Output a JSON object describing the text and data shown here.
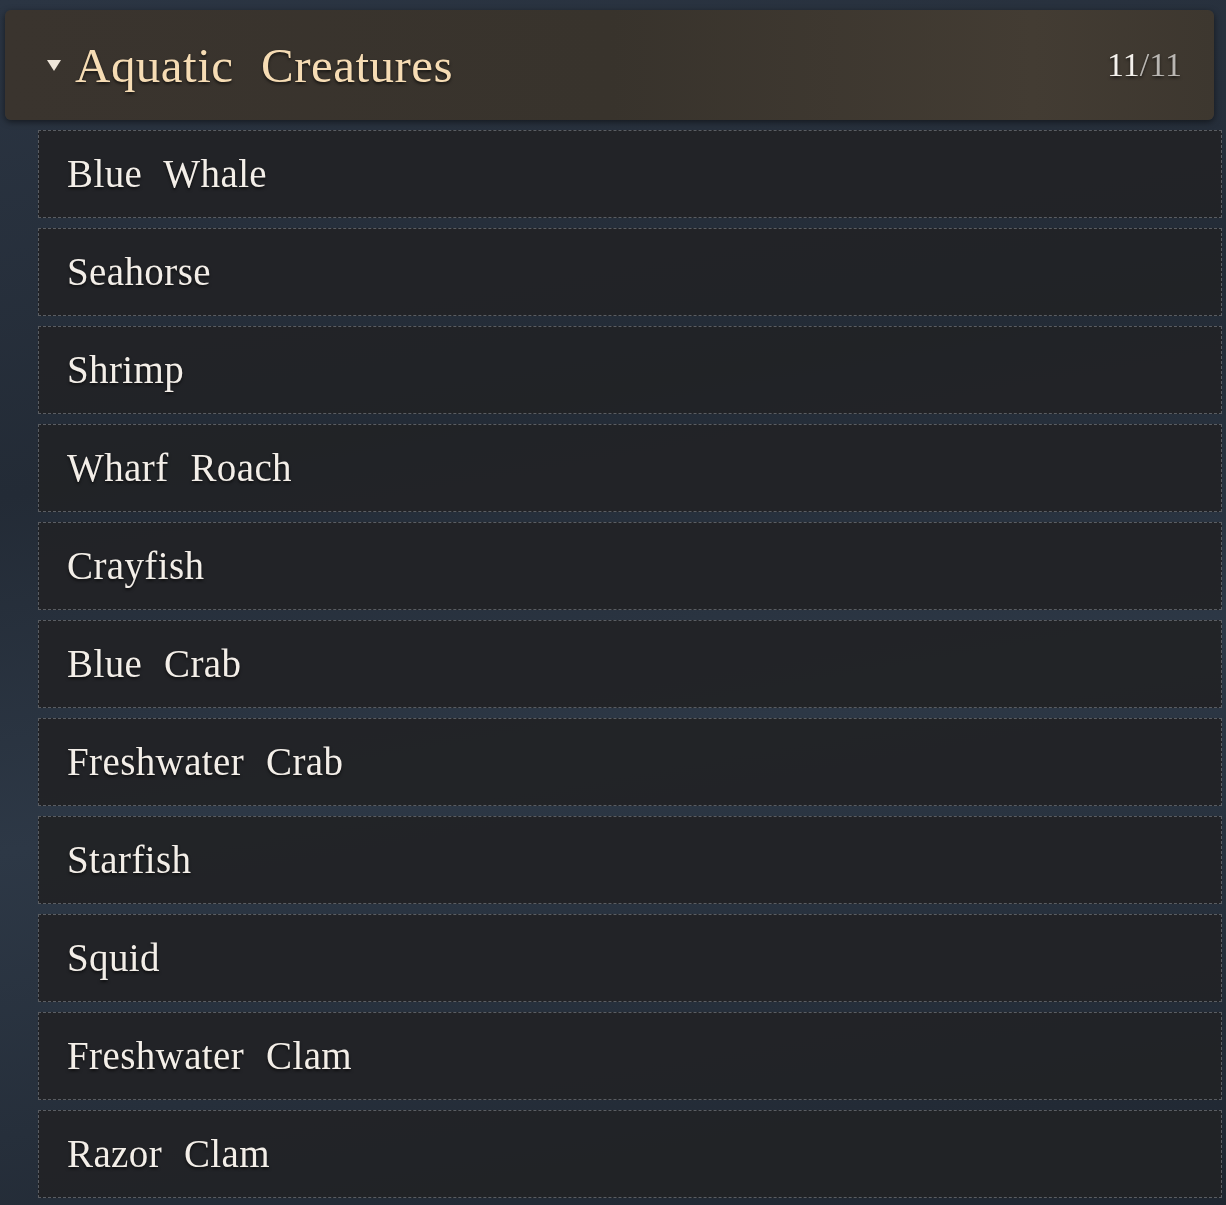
{
  "category": {
    "title": "Aquatic Creatures",
    "expanded": true,
    "count": {
      "found": "11",
      "total": "/11"
    }
  },
  "items": [
    {
      "label": "Blue Whale"
    },
    {
      "label": "Seahorse"
    },
    {
      "label": "Shrimp"
    },
    {
      "label": "Wharf Roach"
    },
    {
      "label": "Crayfish"
    },
    {
      "label": "Blue Crab"
    },
    {
      "label": "Freshwater Crab"
    },
    {
      "label": "Starfish"
    },
    {
      "label": "Squid"
    },
    {
      "label": "Freshwater Clam"
    },
    {
      "label": "Razor Clam"
    }
  ]
}
